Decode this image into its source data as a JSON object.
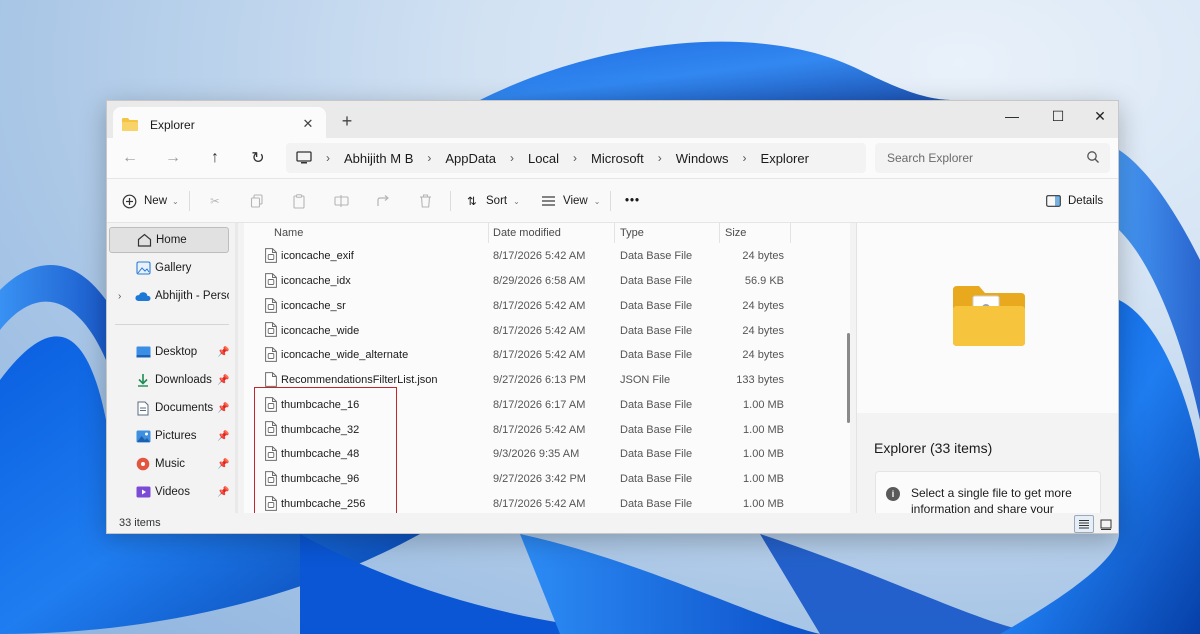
{
  "window": {
    "tab_title": "Explorer"
  },
  "nav": {
    "breadcrumbs": [
      "Abhijith M B",
      "AppData",
      "Local",
      "Microsoft",
      "Windows",
      "Explorer"
    ],
    "search_placeholder": "Search Explorer"
  },
  "toolbar": {
    "new_label": "New",
    "sort_label": "Sort",
    "view_label": "View",
    "more_label": "•••",
    "details_label": "Details"
  },
  "sidebar": {
    "items": [
      {
        "label": "Home",
        "icon": "home-icon"
      },
      {
        "label": "Gallery",
        "icon": "gallery-icon"
      },
      {
        "label": "Abhijith - Personal",
        "icon": "onedrive-icon"
      },
      {
        "label": "Desktop",
        "icon": "desktop-icon"
      },
      {
        "label": "Downloads",
        "icon": "downloads-icon"
      },
      {
        "label": "Documents",
        "icon": "documents-icon"
      },
      {
        "label": "Pictures",
        "icon": "pictures-icon"
      },
      {
        "label": "Music",
        "icon": "music-icon"
      },
      {
        "label": "Videos",
        "icon": "videos-icon"
      }
    ]
  },
  "columns": {
    "name": "Name",
    "date": "Date modified",
    "type": "Type",
    "size": "Size"
  },
  "files": [
    {
      "name": "iconcache_exif",
      "date": "8/17/2026 5:42 AM",
      "type": "Data Base File",
      "size": "24 bytes"
    },
    {
      "name": "iconcache_idx",
      "date": "8/29/2026 6:58 AM",
      "type": "Data Base File",
      "size": "56.9 KB"
    },
    {
      "name": "iconcache_sr",
      "date": "8/17/2026 5:42 AM",
      "type": "Data Base File",
      "size": "24 bytes"
    },
    {
      "name": "iconcache_wide",
      "date": "8/17/2026 5:42 AM",
      "type": "Data Base File",
      "size": "24 bytes"
    },
    {
      "name": "iconcache_wide_alternate",
      "date": "8/17/2026 5:42 AM",
      "type": "Data Base File",
      "size": "24 bytes"
    },
    {
      "name": "RecommendationsFilterList.json",
      "date": "9/27/2026 6:13 PM",
      "type": "JSON File",
      "size": "133 bytes"
    },
    {
      "name": "thumbcache_16",
      "date": "8/17/2026 6:17 AM",
      "type": "Data Base File",
      "size": "1.00 MB"
    },
    {
      "name": "thumbcache_32",
      "date": "8/17/2026 5:42 AM",
      "type": "Data Base File",
      "size": "1.00 MB"
    },
    {
      "name": "thumbcache_48",
      "date": "9/3/2026 9:35 AM",
      "type": "Data Base File",
      "size": "1.00 MB"
    },
    {
      "name": "thumbcache_96",
      "date": "9/27/2026 3:42 PM",
      "type": "Data Base File",
      "size": "1.00 MB"
    },
    {
      "name": "thumbcache_256",
      "date": "8/17/2026 5:42 AM",
      "type": "Data Base File",
      "size": "1.00 MB"
    }
  ],
  "details": {
    "title": "Explorer (33 items)",
    "info": "Select a single file to get more information and share your"
  },
  "status": {
    "count": "33 items"
  },
  "colors": {
    "highlight": "#c0282d",
    "folder": "#f4c542",
    "accent": "#0067c0"
  }
}
